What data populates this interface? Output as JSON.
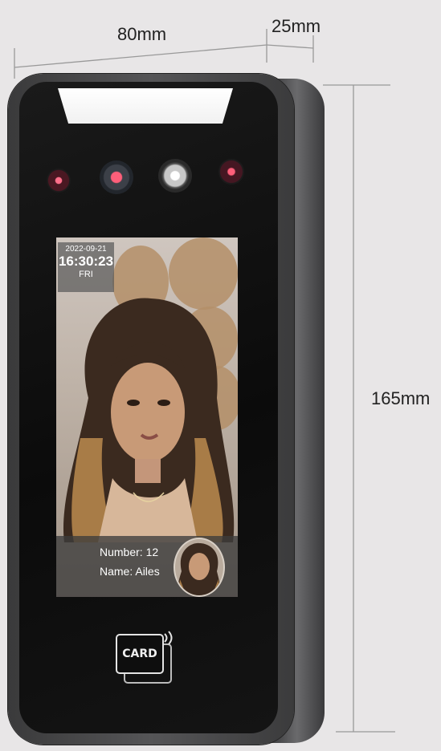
{
  "dimensions": {
    "width": "80mm",
    "depth": "25mm",
    "height": "165mm"
  },
  "screen": {
    "date": "2022-09-21",
    "time": "16:30:23",
    "day": "FRI",
    "number_label": "Number: 12",
    "name_label": "Name: Ailes"
  },
  "card_reader": {
    "label": "CARD"
  },
  "colors": {
    "device_face": "#0b0b0b",
    "device_frame": "#4a4a4c",
    "background": "#e8e6e7",
    "ir_led": "#ff5f7a"
  }
}
